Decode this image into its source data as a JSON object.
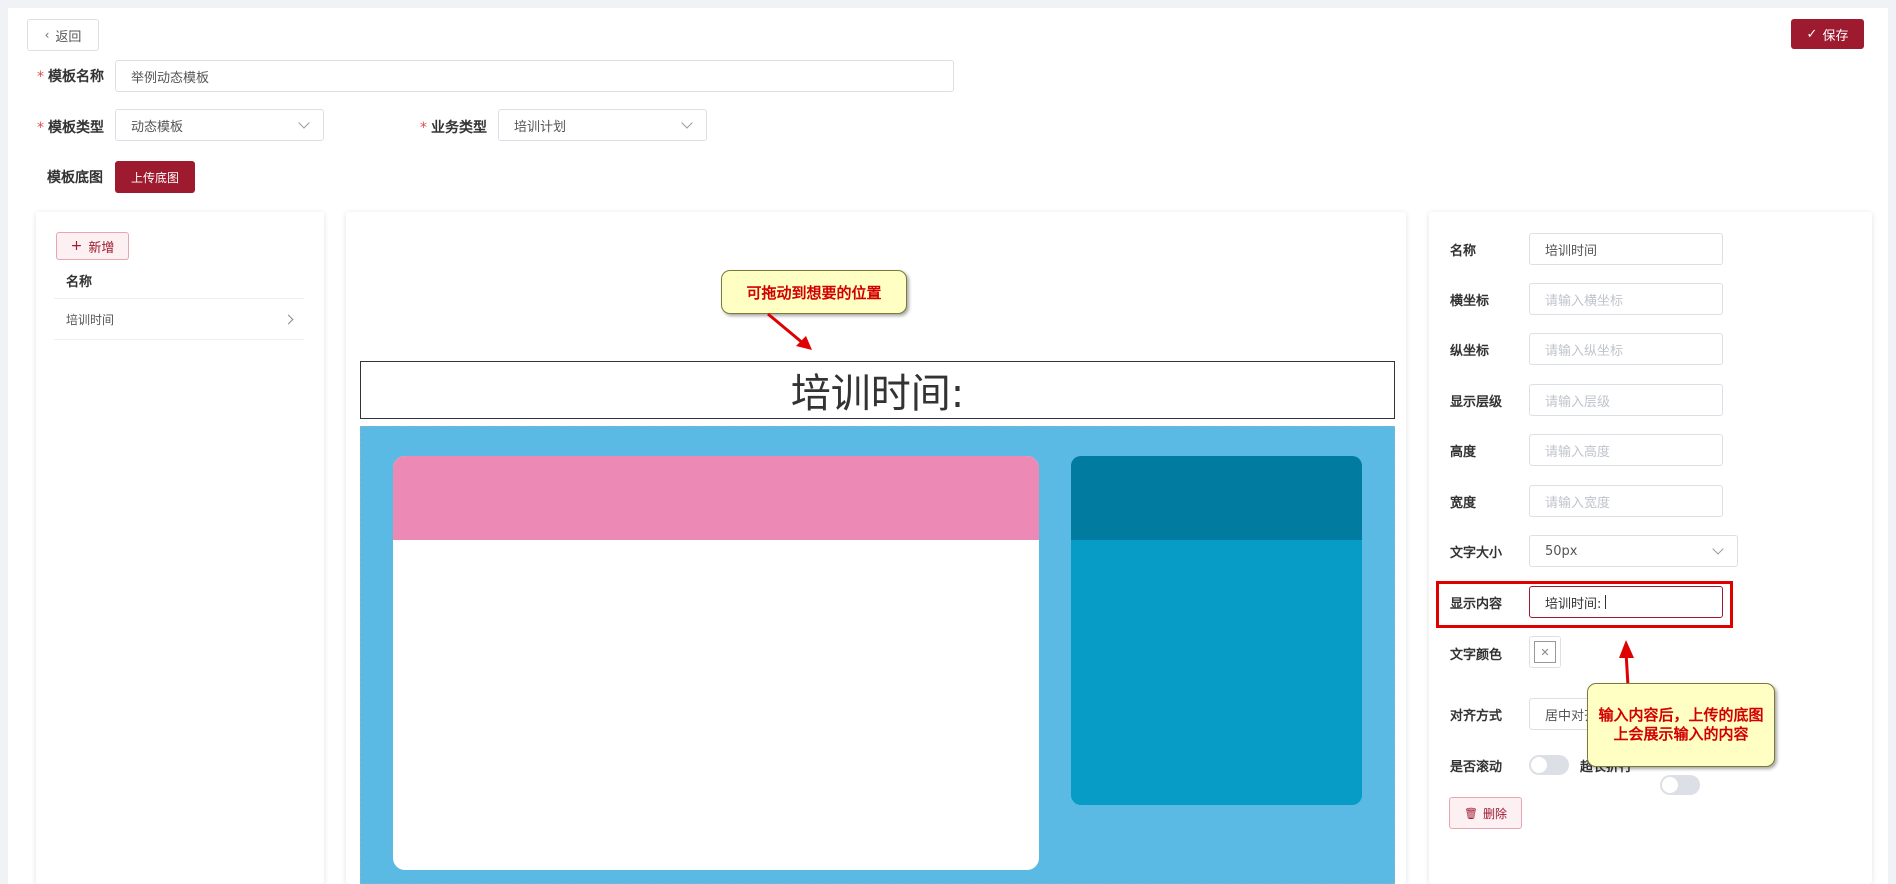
{
  "header": {
    "back_label": "返回",
    "save_label": "保存"
  },
  "form": {
    "template_name_label": "模板名称",
    "template_name_value": "举例动态模板",
    "template_type_label": "模板类型",
    "template_type_value": "动态模板",
    "business_type_label": "业务类型",
    "business_type_value": "培训计划",
    "base_image_label": "模板底图",
    "upload_label": "上传底图"
  },
  "left_panel": {
    "add_label": "新增",
    "column_header": "名称",
    "items": [
      {
        "label": "培训时间"
      }
    ]
  },
  "canvas": {
    "element_text": "培训时间:"
  },
  "callouts": {
    "drag_hint": "可拖动到想要的位置",
    "content_hint": "输入内容后，上传的底图上会展示输入的内容"
  },
  "props": {
    "name_label": "名称",
    "name_value": "培训时间",
    "x_label": "横坐标",
    "x_placeholder": "请输入横坐标",
    "y_label": "纵坐标",
    "y_placeholder": "请输入纵坐标",
    "layer_label": "显示层级",
    "layer_placeholder": "请输入层级",
    "height_label": "高度",
    "height_placeholder": "请输入高度",
    "width_label": "宽度",
    "width_placeholder": "请输入宽度",
    "font_size_label": "文字大小",
    "font_size_value": "50px",
    "content_label": "显示内容",
    "content_value": "培训时间:",
    "color_label": "文字颜色",
    "align_label": "对齐方式",
    "align_value": "居中对齐",
    "scroll_label": "是否滚动",
    "wrap_label": "超长折行",
    "delete_label": "删除"
  },
  "colors": {
    "primary": "#9e1a2f",
    "canvas_bg": "#5bbae4",
    "pink": "#ec8ab5",
    "teal_dark": "#017ca0",
    "teal": "#069cc5",
    "highlight": "#e00000"
  }
}
